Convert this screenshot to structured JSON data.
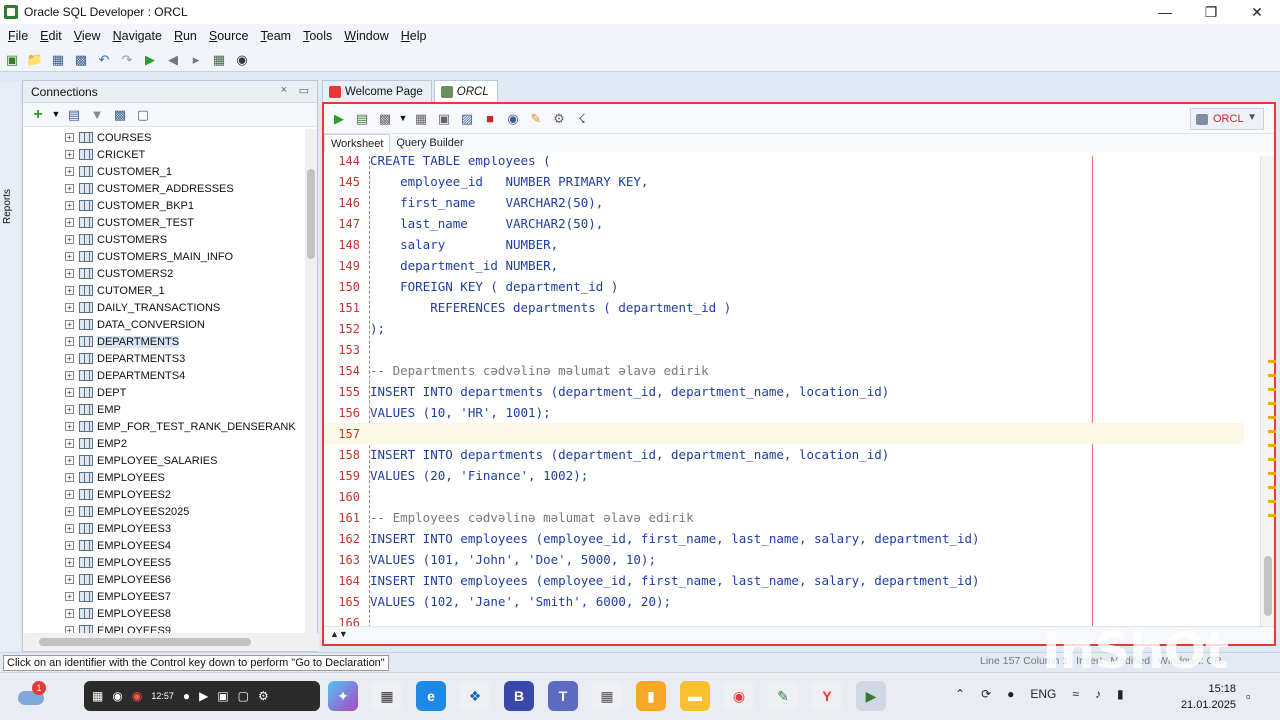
{
  "window": {
    "title": "Oracle SQL Developer : ORCL"
  },
  "menu": [
    "File",
    "Edit",
    "View",
    "Navigate",
    "Run",
    "Source",
    "Team",
    "Tools",
    "Window",
    "Help"
  ],
  "side_strip": {
    "reports_label": "Reports"
  },
  "connections": {
    "title": "Connections",
    "tree": [
      "COURSES",
      "CRICKET",
      "CUSTOMER_1",
      "CUSTOMER_ADDRESSES",
      "CUSTOMER_BKP1",
      "CUSTOMER_TEST",
      "CUSTOMERS",
      "CUSTOMERS_MAIN_INFO",
      "CUSTOMERS2",
      "CUTOMER_1",
      "DAILY_TRANSACTIONS",
      "DATA_CONVERSION",
      "DEPARTMENTS",
      "DEPARTMENTS3",
      "DEPARTMENTS4",
      "DEPT",
      "EMP",
      "EMP_FOR_TEST_RANK_DENSERANK",
      "EMP2",
      "EMPLOYEE_SALARIES",
      "EMPLOYEES",
      "EMPLOYEES2",
      "EMPLOYEES2025",
      "EMPLOYEES3",
      "EMPLOYEES4",
      "EMPLOYEES5",
      "EMPLOYEES6",
      "EMPLOYEES7",
      "EMPLOYEES8",
      "EMPLOYEES9"
    ],
    "selected": "DEPARTMENTS"
  },
  "tabs": [
    {
      "label": "Welcome Page",
      "active": false
    },
    {
      "label": "ORCL",
      "active": true
    }
  ],
  "editor": {
    "connection": "ORCL",
    "subtabs": [
      "Worksheet",
      "Query Builder"
    ],
    "current_line": "157",
    "lines": [
      {
        "n": "144",
        "text": "CREATE TABLE employees (",
        "comment": false
      },
      {
        "n": "145",
        "text": "    employee_id   NUMBER PRIMARY KEY,",
        "comment": false
      },
      {
        "n": "146",
        "text": "    first_name    VARCHAR2(50),",
        "comment": false
      },
      {
        "n": "147",
        "text": "    last_name     VARCHAR2(50),",
        "comment": false
      },
      {
        "n": "148",
        "text": "    salary        NUMBER,",
        "comment": false
      },
      {
        "n": "149",
        "text": "    department_id NUMBER,",
        "comment": false
      },
      {
        "n": "150",
        "text": "    FOREIGN KEY ( department_id )",
        "comment": false
      },
      {
        "n": "151",
        "text": "        REFERENCES departments ( department_id )",
        "comment": false
      },
      {
        "n": "152",
        "text": ");",
        "comment": false
      },
      {
        "n": "153",
        "text": "",
        "comment": false
      },
      {
        "n": "154",
        "text": "-- Departments cədvəlinə məlumat əlavə edirik",
        "comment": true
      },
      {
        "n": "155",
        "text": "INSERT INTO departments (department_id, department_name, location_id)",
        "comment": false
      },
      {
        "n": "156",
        "text": "VALUES (10, 'HR', 1001);",
        "comment": false
      },
      {
        "n": "157",
        "text": "",
        "comment": false
      },
      {
        "n": "158",
        "text": "INSERT INTO departments (department_id, department_name, location_id)",
        "comment": false
      },
      {
        "n": "159",
        "text": "VALUES (20, 'Finance', 1002);",
        "comment": false
      },
      {
        "n": "160",
        "text": "",
        "comment": false
      },
      {
        "n": "161",
        "text": "-- Employees cədvəlinə məlumat əlavə edirik",
        "comment": true
      },
      {
        "n": "162",
        "text": "INSERT INTO employees (employee_id, first_name, last_name, salary, department_id)",
        "comment": false
      },
      {
        "n": "163",
        "text": "VALUES (101, 'John', 'Doe', 5000, 10);",
        "comment": false
      },
      {
        "n": "164",
        "text": "INSERT INTO employees (employee_id, first_name, last_name, salary, department_id)",
        "comment": false
      },
      {
        "n": "165",
        "text": "VALUES (102, 'Jane', 'Smith', 6000, 20);",
        "comment": false
      },
      {
        "n": "166",
        "text": "",
        "comment": false
      }
    ]
  },
  "status": {
    "message": "Click on an identifier with the Control key down to perform \"Go to Declaration\"",
    "position": "Line 157 Column 1",
    "mode": "Insert",
    "modified": "Modified",
    "eol": "Windows: CR"
  },
  "watermark": "InShOt",
  "taskbar": {
    "weather_badge": "1",
    "recorder_time": "12:57",
    "lang": "ENG",
    "time": "15:18",
    "date": "21.01.2025"
  },
  "colors": {
    "accent_red": "#e53935",
    "code_blue": "#1f3fa0",
    "line_number_red": "#c0392b"
  }
}
